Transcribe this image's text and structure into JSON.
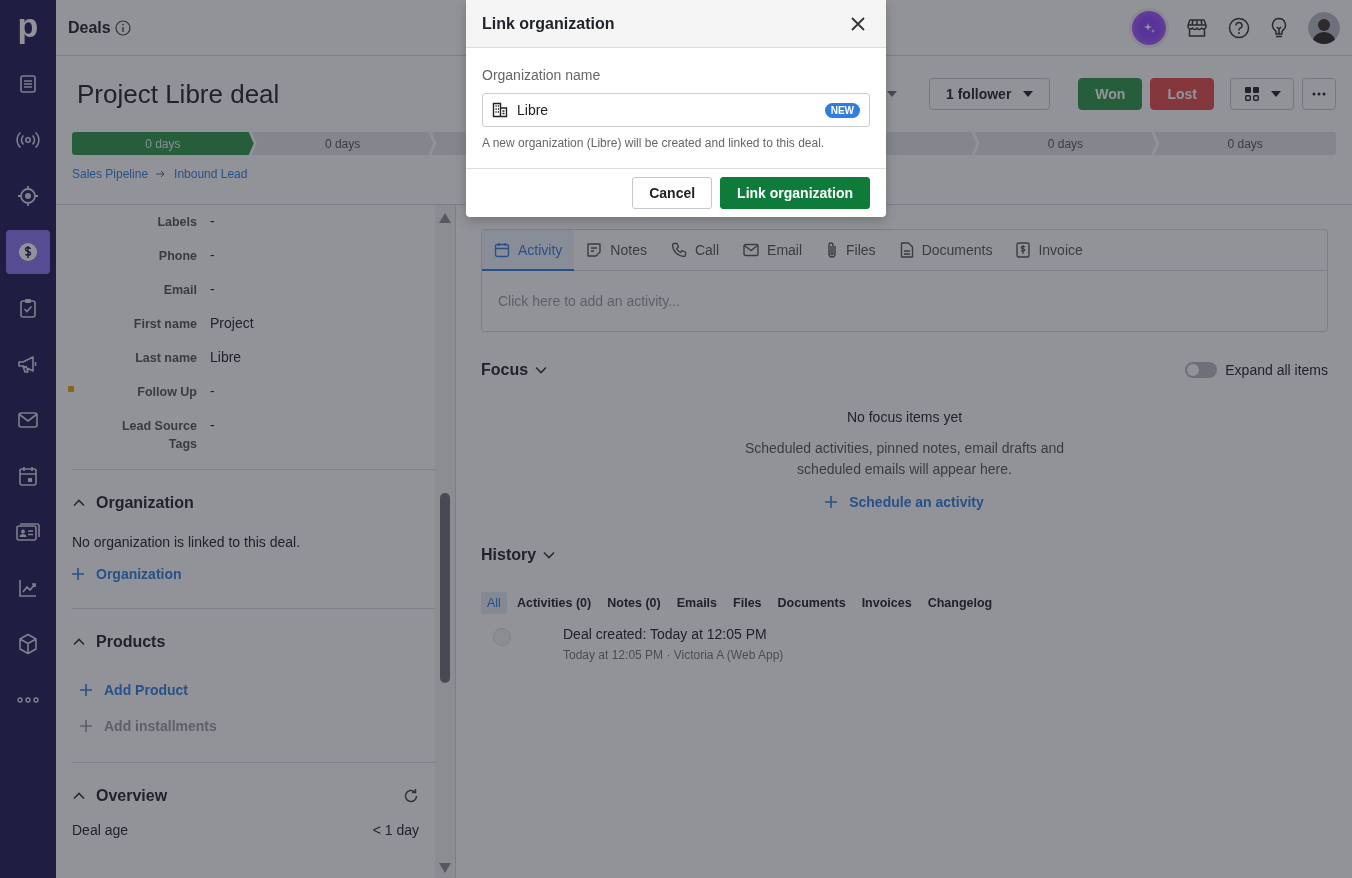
{
  "nav": {
    "logo": "p",
    "items": [
      {
        "kind": "leads",
        "selected": false
      },
      {
        "kind": "broadcast",
        "selected": false
      },
      {
        "kind": "target",
        "selected": false
      },
      {
        "kind": "deals",
        "selected": true
      },
      {
        "kind": "tasks",
        "selected": false
      },
      {
        "kind": "campaigns",
        "selected": false
      },
      {
        "kind": "mail",
        "selected": false
      },
      {
        "kind": "calendar",
        "selected": false
      },
      {
        "kind": "contacts",
        "selected": false
      },
      {
        "kind": "insights",
        "selected": false
      },
      {
        "kind": "products",
        "selected": false
      },
      {
        "kind": "more",
        "selected": false
      }
    ]
  },
  "topbar": {
    "title": "Deals"
  },
  "deal": {
    "title": "Project Libre deal",
    "followers": "1 follower",
    "won": "Won",
    "lost": "Lost"
  },
  "stages": [
    {
      "label": "0 days",
      "reached": true
    },
    {
      "label": "0 days",
      "reached": false
    },
    {
      "reached": false
    },
    {
      "label": "0 days",
      "reached": false
    },
    {
      "label": "0 days",
      "reached": false
    }
  ],
  "breadcrumb": [
    "Sales Pipeline",
    "Inbound Lead"
  ],
  "fields": [
    {
      "label": "Labels",
      "value": "-",
      "flagged": false
    },
    {
      "label": "Phone",
      "value": "-",
      "flagged": false
    },
    {
      "label": "Email",
      "value": "-",
      "flagged": false
    },
    {
      "label": "First name",
      "value": "Project",
      "flagged": false
    },
    {
      "label": "Last name",
      "value": "Libre",
      "flagged": false
    },
    {
      "label": "Follow Up",
      "value": "-",
      "flagged": true
    },
    {
      "label": "Lead Source Tags",
      "value": "-",
      "flagged": false
    }
  ],
  "organization_section": {
    "title": "Organization",
    "expanded": true,
    "empty_text": "No organization is linked to this deal.",
    "add_link": "Organization"
  },
  "products_section": {
    "title": "Products",
    "expanded": true,
    "add_product": {
      "label": "Add Product",
      "disabled": false
    },
    "add_installments": {
      "label": "Add installments",
      "disabled": true
    }
  },
  "overview_section": {
    "title": "Overview",
    "expanded": true,
    "rows": [
      {
        "label": "Deal age",
        "value": "< 1 day"
      }
    ]
  },
  "composer": {
    "tabs": [
      {
        "kind": "activity",
        "label": "Activity",
        "selected": true
      },
      {
        "kind": "notes",
        "label": "Notes",
        "selected": false
      },
      {
        "kind": "call",
        "label": "Call",
        "selected": false
      },
      {
        "kind": "email",
        "label": "Email",
        "selected": false
      },
      {
        "kind": "files",
        "label": "Files",
        "selected": false
      },
      {
        "kind": "documents",
        "label": "Documents",
        "selected": false
      },
      {
        "kind": "invoice",
        "label": "Invoice",
        "selected": false
      }
    ],
    "placeholder": "Click here to add an activity..."
  },
  "focus": {
    "title": "Focus",
    "expand_all": {
      "label": "Expand all items",
      "on": false
    },
    "empty_title": "No focus items yet",
    "empty_text": "Scheduled activities, pinned notes, email drafts and scheduled emails will appear here.",
    "action": "Schedule an activity"
  },
  "history": {
    "title": "History",
    "filters": [
      {
        "label": "All",
        "selected": true
      },
      {
        "label": "Activities (0)",
        "selected": false
      },
      {
        "label": "Notes (0)",
        "selected": false
      },
      {
        "label": "Emails",
        "selected": false
      },
      {
        "label": "Files",
        "selected": false
      },
      {
        "label": "Documents",
        "selected": false
      },
      {
        "label": "Invoices",
        "selected": false
      },
      {
        "label": "Changelog",
        "selected": false
      }
    ],
    "events": [
      {
        "title": "Deal created: Today at 12:05 PM",
        "meta": "Today at 12:05 PM · Victoria A (Web App)"
      }
    ]
  },
  "modal": {
    "title": "Link organization",
    "field_label": "Organization name",
    "value": "Libre",
    "badge": "NEW",
    "hint": "A new organization (Libre) will be created and linked to this deal.",
    "cancel": "Cancel",
    "confirm": "Link organization"
  }
}
